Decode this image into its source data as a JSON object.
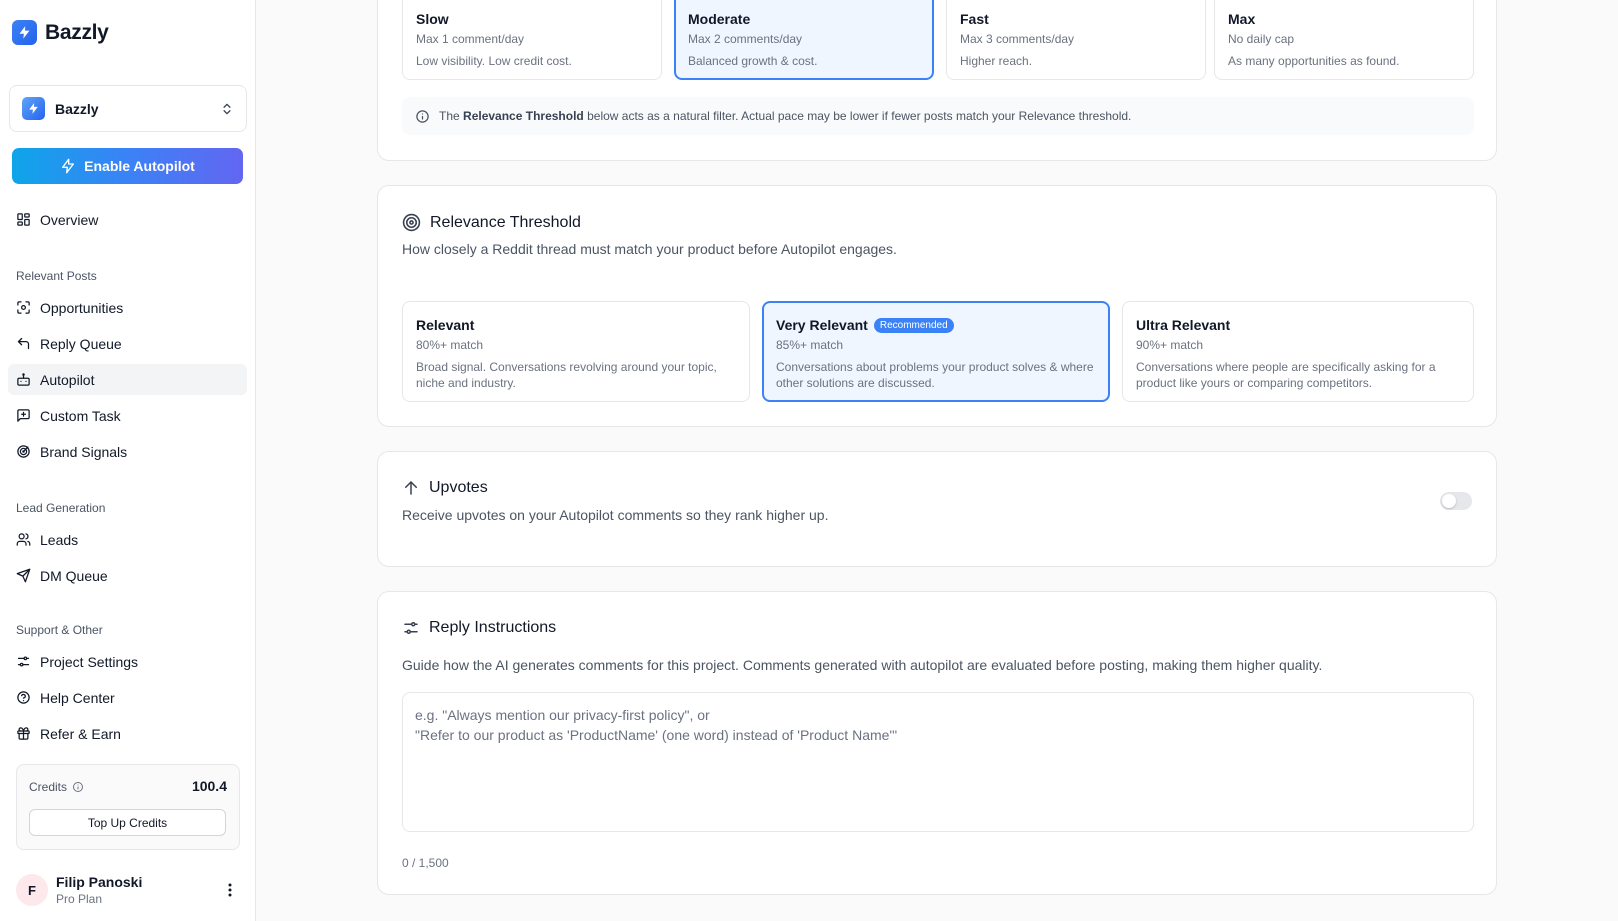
{
  "app": {
    "name": "Bazzly"
  },
  "project": {
    "name": "Bazzly"
  },
  "sidebar": {
    "autopilot_button": "Enable Autopilot",
    "overview": "Overview",
    "sections": [
      {
        "label": "Relevant Posts",
        "items": [
          "Opportunities",
          "Reply Queue",
          "Autopilot",
          "Custom Task",
          "Brand Signals"
        ]
      },
      {
        "label": "Lead Generation",
        "items": [
          "Leads",
          "DM Queue"
        ]
      },
      {
        "label": "Support & Other",
        "items": [
          "Project Settings",
          "Help Center",
          "Refer & Earn"
        ]
      }
    ],
    "active_item": "Autopilot",
    "credits": {
      "label": "Credits",
      "value": "100.4",
      "button": "Top Up Credits"
    },
    "user": {
      "initial": "F",
      "name": "Filip Panoski",
      "plan": "Pro Plan"
    }
  },
  "pace": {
    "options": [
      {
        "title": "Slow",
        "sub": "Max 1 comment/day",
        "desc": "Low visibility. Low credit cost."
      },
      {
        "title": "Moderate",
        "sub": "Max 2 comments/day",
        "desc": "Balanced growth & cost."
      },
      {
        "title": "Fast",
        "sub": "Max 3 comments/day",
        "desc": "Higher reach."
      },
      {
        "title": "Max",
        "sub": "No daily cap",
        "desc": "As many opportunities as found."
      }
    ],
    "selected": "Moderate",
    "info": {
      "prefix": "The",
      "bold": "Relevance Threshold",
      "suffix": "below acts as a natural filter. Actual pace may be lower if fewer posts match your Relevance threshold."
    }
  },
  "relevance": {
    "title": "Relevance Threshold",
    "desc": "How closely a Reddit thread must match your product before Autopilot engages.",
    "options": [
      {
        "title": "Relevant",
        "sub": "80%+ match",
        "desc": "Broad signal. Conversations revolving around your topic, niche and industry."
      },
      {
        "title": "Very Relevant",
        "badge": "Recommended",
        "sub": "85%+ match",
        "desc": "Conversations about problems your product solves & where other solutions are discussed."
      },
      {
        "title": "Ultra Relevant",
        "sub": "90%+ match",
        "desc": "Conversations where people are specifically asking for a product like yours or comparing competitors."
      }
    ],
    "selected": "Very Relevant"
  },
  "upvotes": {
    "title": "Upvotes",
    "desc": "Receive upvotes on your Autopilot comments so they rank higher up.",
    "enabled": false
  },
  "instructions": {
    "title": "Reply Instructions",
    "desc": "Guide how the AI generates comments for this project. Comments generated with autopilot are evaluated before posting, making them higher quality.",
    "placeholder": "e.g. \"Always mention our privacy-first policy\", or\n\"Refer to our product as 'ProductName' (one word) instead of 'Product Name'\"",
    "value": "",
    "counter": "0 / 1,500"
  },
  "colors": {
    "accent": "#3b82f6",
    "selected_bg": "#eff6ff",
    "gradient_start": "#0ea5e9",
    "gradient_end": "#6366f1"
  }
}
